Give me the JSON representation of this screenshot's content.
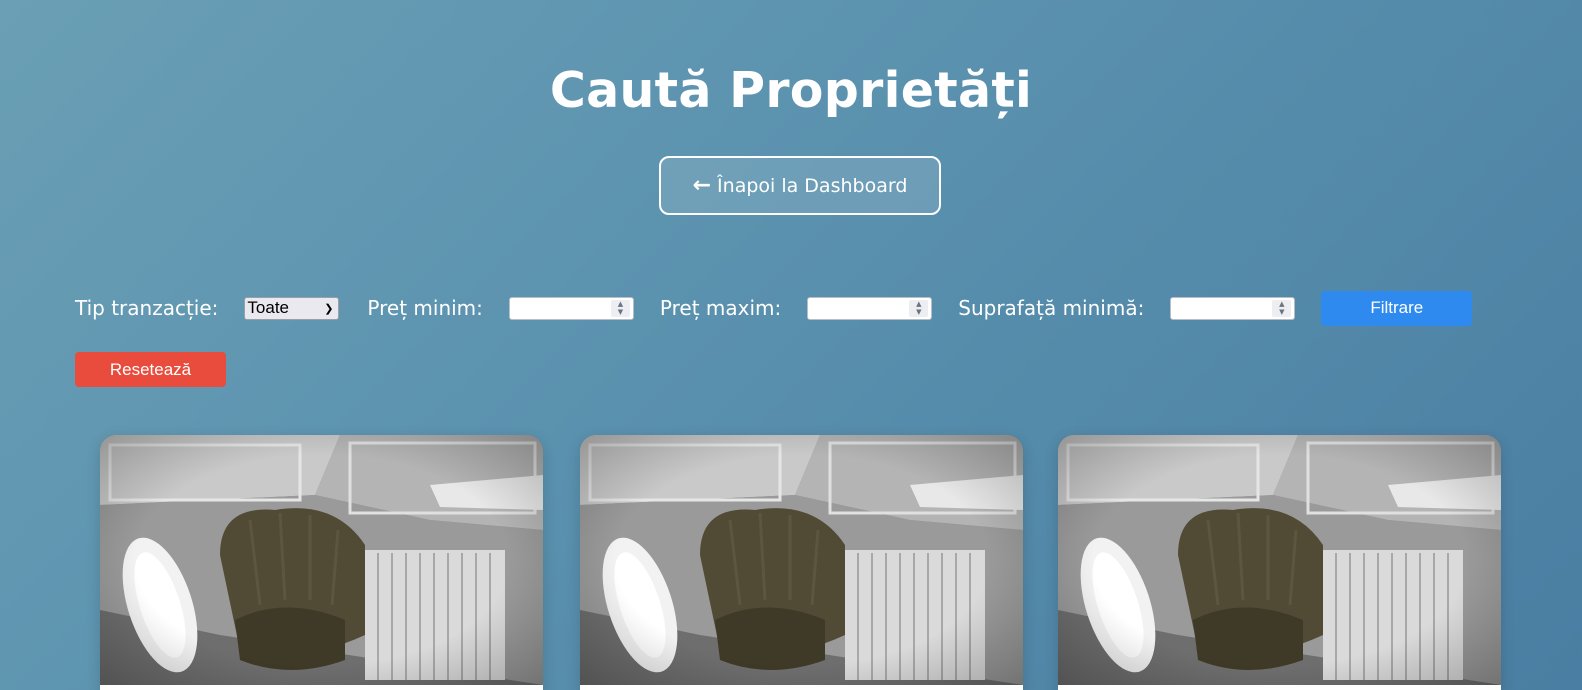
{
  "header": {
    "title": "Caută Proprietăți",
    "back_label": "Înapoi la Dashboard",
    "back_icon": "arrow-left-icon"
  },
  "filters": {
    "transaction_label": "Tip tranzacție:",
    "transaction_selected": "Toate",
    "min_price_label": "Preț minim:",
    "min_price_value": "",
    "max_price_label": "Preț maxim:",
    "max_price_value": "",
    "min_area_label": "Suprafață minimă:",
    "min_area_value": "",
    "filter_label": "Filtrare",
    "reset_label": "Resetează"
  },
  "colors": {
    "filter_button": "#2f8af0",
    "reset_button": "#e94b3c"
  },
  "properties": [
    {
      "image": "armchair-radiator-photo"
    },
    {
      "image": "armchair-radiator-photo"
    },
    {
      "image": "armchair-radiator-photo"
    }
  ]
}
